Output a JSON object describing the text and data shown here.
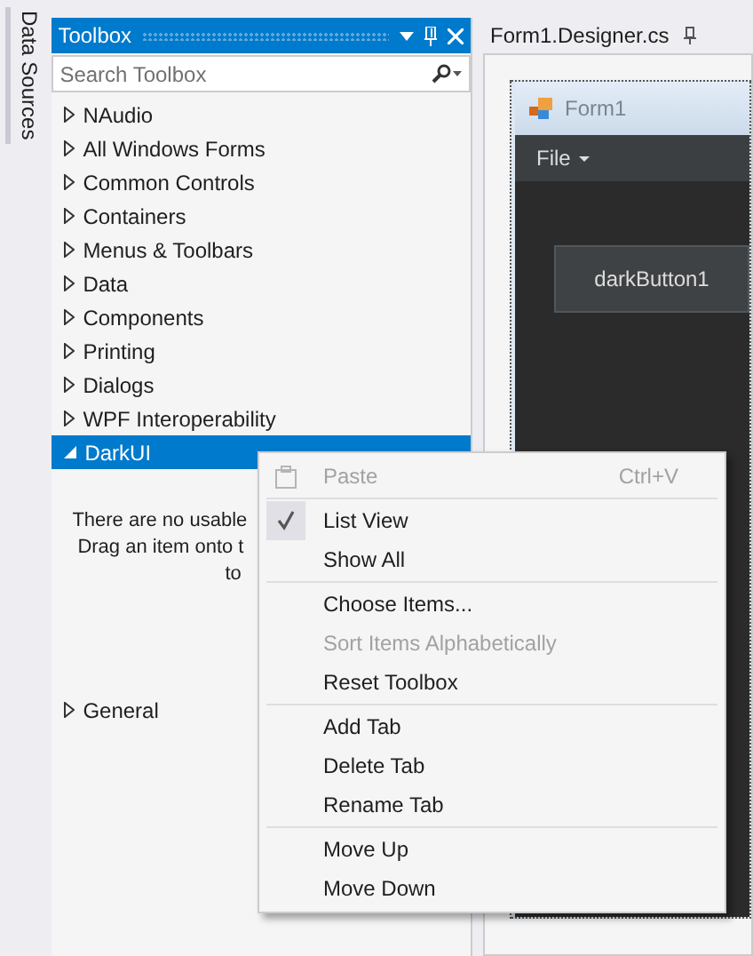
{
  "side_tab": {
    "label": "Data Sources"
  },
  "toolbox": {
    "title": "Toolbox",
    "search": {
      "placeholder": "Search Toolbox"
    },
    "groups": [
      {
        "label": "NAudio",
        "expanded": false,
        "selected": false
      },
      {
        "label": "All Windows Forms",
        "expanded": false,
        "selected": false
      },
      {
        "label": "Common Controls",
        "expanded": false,
        "selected": false
      },
      {
        "label": "Containers",
        "expanded": false,
        "selected": false
      },
      {
        "label": "Menus & Toolbars",
        "expanded": false,
        "selected": false
      },
      {
        "label": "Data",
        "expanded": false,
        "selected": false
      },
      {
        "label": "Components",
        "expanded": false,
        "selected": false
      },
      {
        "label": "Printing",
        "expanded": false,
        "selected": false
      },
      {
        "label": "Dialogs",
        "expanded": false,
        "selected": false
      },
      {
        "label": "WPF Interoperability",
        "expanded": false,
        "selected": false
      },
      {
        "label": "DarkUI",
        "expanded": true,
        "selected": true,
        "message": [
          "There are no usable",
          "Drag an item onto t",
          "to"
        ]
      },
      {
        "label": "General",
        "expanded": false,
        "selected": false
      }
    ]
  },
  "document_tab": {
    "label": "Form1.Designer.cs"
  },
  "form": {
    "title": "Form1",
    "menu": [
      {
        "label": "File"
      }
    ],
    "button": {
      "label": "darkButton1"
    }
  },
  "context_menu": [
    {
      "kind": "item",
      "label": "Paste",
      "shortcut": "Ctrl+V",
      "disabled": true,
      "checked": false,
      "has_icon": true
    },
    {
      "kind": "separator"
    },
    {
      "kind": "item",
      "label": "List View",
      "disabled": false,
      "checked": true
    },
    {
      "kind": "item",
      "label": "Show All",
      "disabled": false,
      "checked": false
    },
    {
      "kind": "separator"
    },
    {
      "kind": "item",
      "label": "Choose Items...",
      "disabled": false,
      "checked": false
    },
    {
      "kind": "item",
      "label": "Sort Items Alphabetically",
      "disabled": true,
      "checked": false
    },
    {
      "kind": "item",
      "label": "Reset Toolbox",
      "disabled": false,
      "checked": false
    },
    {
      "kind": "separator"
    },
    {
      "kind": "item",
      "label": "Add Tab",
      "disabled": false,
      "checked": false
    },
    {
      "kind": "item",
      "label": "Delete Tab",
      "disabled": false,
      "checked": false
    },
    {
      "kind": "item",
      "label": "Rename Tab",
      "disabled": false,
      "checked": false
    },
    {
      "kind": "separator"
    },
    {
      "kind": "item",
      "label": "Move Up",
      "disabled": false,
      "checked": false
    },
    {
      "kind": "item",
      "label": "Move Down",
      "disabled": false,
      "checked": false
    }
  ]
}
